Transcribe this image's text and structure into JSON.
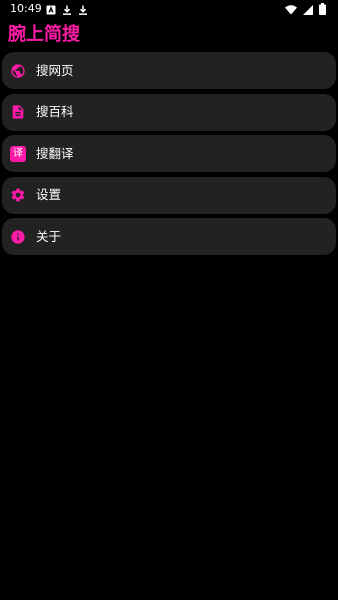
{
  "colors": {
    "accent": "#ff1aa8",
    "item_bg": "#222222",
    "background": "#000000",
    "text": "#ffffff"
  },
  "status_bar": {
    "time": "10:49",
    "left_icons": [
      "notification-a-icon",
      "download-icon",
      "download-icon"
    ],
    "right_icons": [
      "wifi-icon",
      "cellular-signal-icon",
      "battery-icon"
    ]
  },
  "app": {
    "title": "腕上简搜"
  },
  "menu": {
    "items": [
      {
        "label": "搜网页",
        "icon": "globe-icon"
      },
      {
        "label": "搜百科",
        "icon": "document-icon"
      },
      {
        "label": "搜翻译",
        "icon": "translate-icon",
        "badge_text": "译"
      },
      {
        "label": "设置",
        "icon": "gear-icon"
      },
      {
        "label": "关于",
        "icon": "info-icon"
      }
    ]
  }
}
